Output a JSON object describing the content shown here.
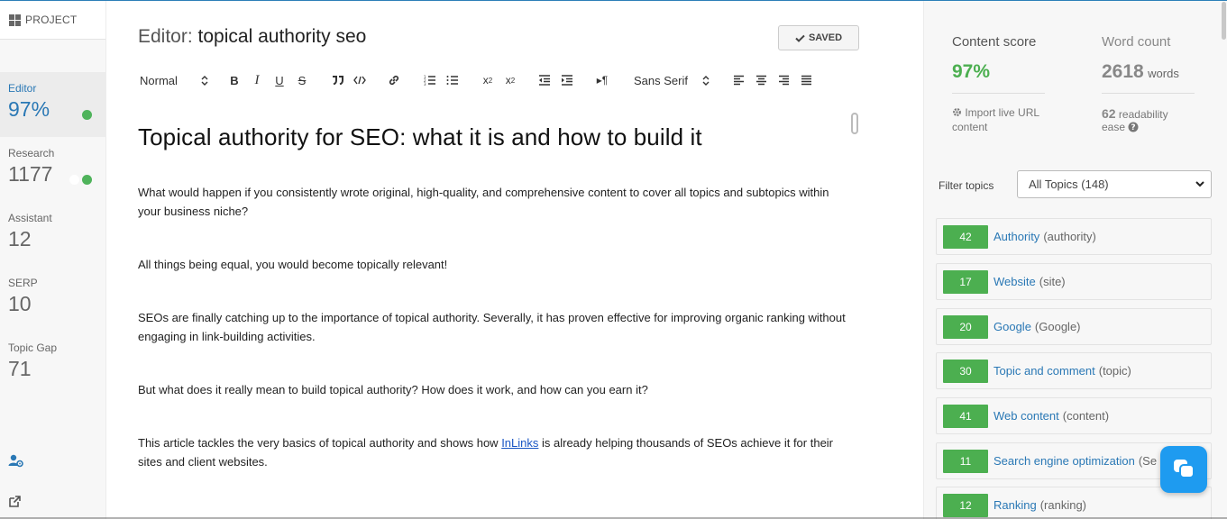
{
  "sidebar": {
    "project_label": "PROJECT",
    "items": [
      {
        "label": "Editor",
        "value": "97%",
        "active": true
      },
      {
        "label": "Research",
        "value": "1177"
      },
      {
        "label": "Assistant",
        "value": "12"
      },
      {
        "label": "SERP",
        "value": "10"
      },
      {
        "label": "Topic Gap",
        "value": "71"
      }
    ],
    "icons": [
      "grid-icon",
      "user-settings-icon",
      "external-link-icon"
    ]
  },
  "editor": {
    "title_prefix": "Editor:",
    "title_name": "topical authority seo",
    "saved_label": "SAVED",
    "toolbar": {
      "format_select": "Normal",
      "font_select": "Sans Serif"
    },
    "heading": "Topical authority for SEO: what it is and how to build it",
    "paragraphs": [
      "What would happen if you consistently wrote original, high-quality, and comprehensive content to cover all topics and subtopics within your business niche?",
      "All things being equal, you would become topically relevant!",
      "SEOs are finally catching up to the importance of topical authority. Severally, it has proven effective for improving organic ranking without engaging in link-building activities.",
      "But what does it really mean to build topical authority? How does it work, and how can you earn it?"
    ],
    "last_paragraph": {
      "before": "This article tackles the very basics of topical authority and shows how ",
      "link": "InLinks",
      "after": " is already helping thousands of SEOs achieve it for their sites and client websites."
    }
  },
  "panel": {
    "content_score_title": "Content score",
    "content_score_value": "97%",
    "word_count_title": "Word count",
    "word_count_value": "2618",
    "word_count_unit": "words",
    "import_label": "Import live URL content",
    "readability_value": "62",
    "readability_label": "readability ease",
    "filter_label": "Filter topics",
    "filter_value": "All Topics (148)",
    "topics": [
      {
        "count": "42",
        "name": "Authority",
        "alt": "(authority)"
      },
      {
        "count": "17",
        "name": "Website",
        "alt": "(site)"
      },
      {
        "count": "20",
        "name": "Google",
        "alt": "(Google)"
      },
      {
        "count": "30",
        "name": "Topic and comment",
        "alt": "(topic)"
      },
      {
        "count": "41",
        "name": "Web content",
        "alt": "(content)"
      },
      {
        "count": "11",
        "name": "Search engine optimization",
        "alt": "(Se"
      },
      {
        "count": "12",
        "name": "Ranking",
        "alt": "(ranking)"
      }
    ]
  },
  "colors": {
    "accent_blue": "#2a78b5",
    "score_green": "#4caf50",
    "chat_blue": "#1e9bf0"
  }
}
